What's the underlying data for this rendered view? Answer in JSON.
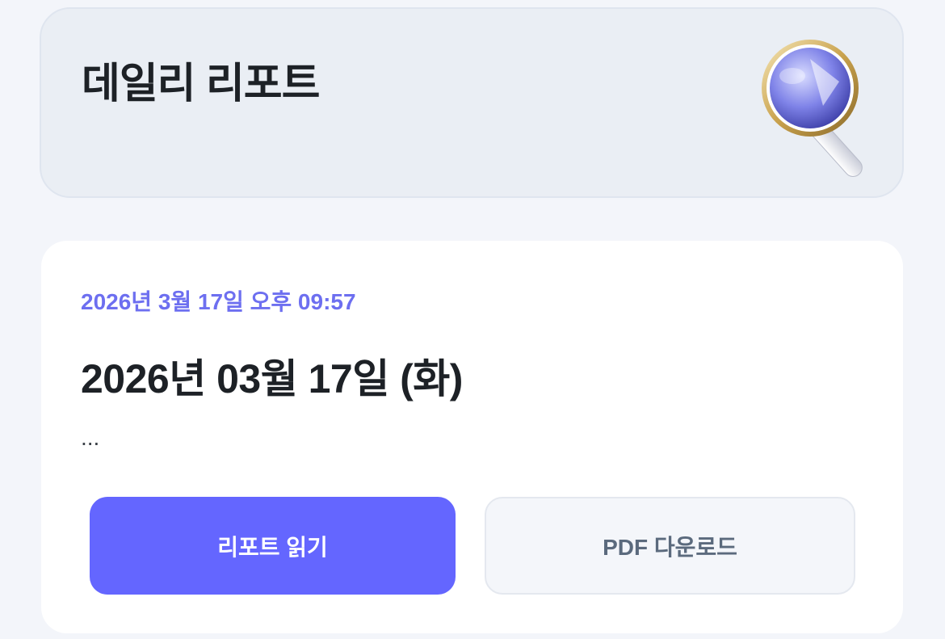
{
  "header": {
    "title": "데일리 리포트",
    "icon": "magnifying-glass-icon"
  },
  "report": {
    "timestamp": "2026년 3월 17일 오후 09:57",
    "date_title": "2026년 03월 17일 (화)",
    "summary": "...",
    "read_button_label": "리포트 읽기",
    "pdf_button_label": "PDF 다운로드"
  },
  "colors": {
    "accent": "#6466ff",
    "timestamp": "#6d6ff0",
    "page_background": "#f3f5fa",
    "header_background": "#eaeef4"
  }
}
